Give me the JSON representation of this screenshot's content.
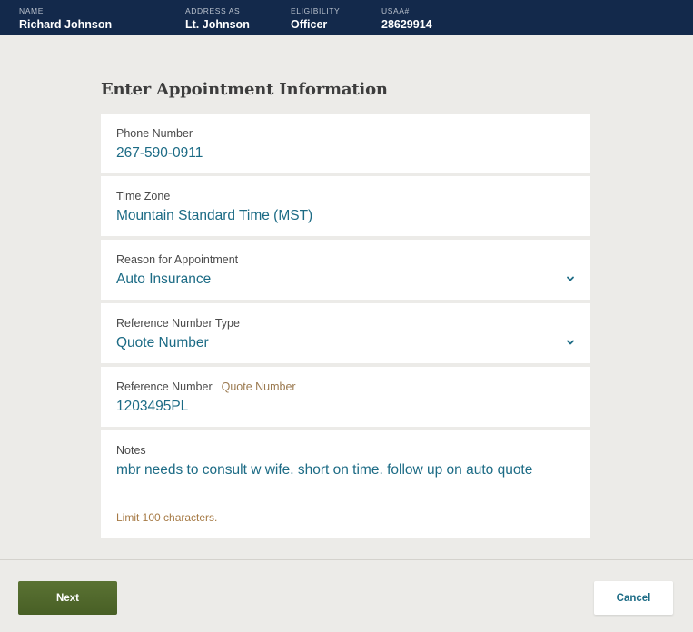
{
  "header": {
    "fields": [
      {
        "label": "NAME",
        "value": "Richard Johnson"
      },
      {
        "label": "ADDRESS AS",
        "value": "Lt. Johnson"
      },
      {
        "label": "ELIGIBILITY",
        "value": "Officer"
      },
      {
        "label": "USAA#",
        "value": "28629914"
      }
    ]
  },
  "form": {
    "title": "Enter Appointment Information",
    "phone": {
      "label": "Phone Number",
      "value": "267-590-0911"
    },
    "time_zone": {
      "label": "Time Zone",
      "value": "Mountain Standard Time (MST)"
    },
    "reason": {
      "label": "Reason for Appointment",
      "value": "Auto Insurance",
      "icon": "chevron-down-icon"
    },
    "ref_type": {
      "label": "Reference Number Type",
      "value": "Quote Number",
      "icon": "chevron-down-icon"
    },
    "ref_number": {
      "label": "Reference Number",
      "hint": "Quote Number",
      "value": "1203495PL"
    },
    "notes": {
      "label": "Notes",
      "value": "mbr needs to consult w wife. short on time. follow up on auto quote",
      "limit_text": "Limit 100 characters."
    }
  },
  "actions": {
    "next_label": "Next",
    "cancel_label": "Cancel"
  },
  "colors": {
    "header_bg": "#13294b",
    "accent_text": "#1c6b85",
    "next_button": "#556b2f",
    "hint": "#9b7a50"
  }
}
